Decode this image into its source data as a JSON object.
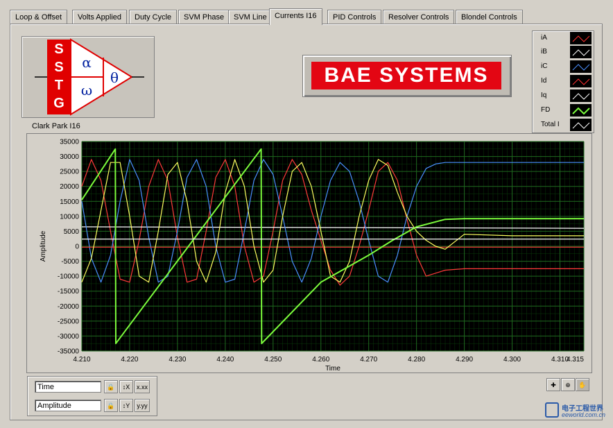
{
  "tabs": [
    {
      "label": "Loop & Offset",
      "active": false
    },
    {
      "label": "Volts Applied",
      "active": false
    },
    {
      "label": "Duty Cycle",
      "active": false
    },
    {
      "label": "SVM Phase",
      "active": false
    },
    {
      "label": "SVM Line",
      "active": false
    },
    {
      "label": "Currents I16",
      "active": true
    },
    {
      "label": "PID Controls",
      "active": false
    },
    {
      "label": "Resolver Controls",
      "active": false
    },
    {
      "label": "Blondel Controls",
      "active": false
    }
  ],
  "logo": {
    "letters": [
      "S",
      "S",
      "T",
      "G"
    ],
    "alpha": "α",
    "omega": "ω",
    "theta": "θ"
  },
  "bae": {
    "text": "BAE SYSTEMS"
  },
  "caption": "Clark Park  I16",
  "legend": [
    {
      "label": "iA",
      "color": "#ff3030"
    },
    {
      "label": "iB",
      "color": "#ffffff"
    },
    {
      "label": "iC",
      "color": "#4a90ff"
    },
    {
      "label": "Id",
      "color": "#ff3030"
    },
    {
      "label": "Iq",
      "color": "#ffffff"
    },
    {
      "label": "FD",
      "color": "#7cfc3c"
    },
    {
      "label": "Total I",
      "color": "#ffffff"
    }
  ],
  "controls": {
    "x_name": "Time",
    "y_name": "Amplitude",
    "x_fmt_label": "x.xx",
    "y_fmt_label": "y.yy"
  },
  "watermark": {
    "line1": "电子工程世界",
    "line2": "eeworld.com.cn"
  },
  "chart_data": {
    "type": "line",
    "xlabel": "Time",
    "ylabel": "Amplitude",
    "xlim": [
      4.21,
      4.315
    ],
    "ylim": [
      -35000,
      35000
    ],
    "xticks": [
      "4.210",
      "4.220",
      "4.230",
      "4.240",
      "4.250",
      "4.260",
      "4.270",
      "4.280",
      "4.290",
      "4.300",
      "4.310",
      "4.315"
    ],
    "xtick_values": [
      4.21,
      4.22,
      4.23,
      4.24,
      4.25,
      4.26,
      4.27,
      4.28,
      4.29,
      4.3,
      4.31,
      4.315
    ],
    "yticks": [
      "35000",
      "30000",
      "25000",
      "20000",
      "15000",
      "10000",
      "5000",
      "0",
      "-5000",
      "-10000",
      "-15000",
      "-20000",
      "-25000",
      "-30000",
      "-35000"
    ],
    "ytick_values": [
      35000,
      30000,
      25000,
      20000,
      15000,
      10000,
      5000,
      0,
      -5000,
      -10000,
      -15000,
      -20000,
      -25000,
      -30000,
      -35000
    ],
    "grid": true,
    "series": [
      {
        "name": "iA",
        "color": "#ff3a3a",
        "x": [
          4.21,
          4.212,
          4.214,
          4.216,
          4.218,
          4.22,
          4.222,
          4.224,
          4.226,
          4.228,
          4.23,
          4.232,
          4.234,
          4.236,
          4.238,
          4.24,
          4.242,
          4.244,
          4.246,
          4.248,
          4.25,
          4.252,
          4.254,
          4.256,
          4.258,
          4.26,
          4.262,
          4.264,
          4.266,
          4.268,
          4.27,
          4.272,
          4.274,
          4.276,
          4.278,
          4.28,
          4.282,
          4.284,
          4.286,
          4.29,
          4.3,
          4.31,
          4.315
        ],
        "y": [
          20000,
          29000,
          22000,
          5000,
          -11000,
          -12000,
          2000,
          20000,
          29000,
          22000,
          3000,
          -12000,
          -11000,
          5000,
          23000,
          29000,
          20000,
          0,
          -12000,
          -10000,
          5000,
          22000,
          29000,
          24000,
          12000,
          2000,
          -8000,
          -13000,
          -10000,
          0,
          12000,
          25000,
          28000,
          22000,
          9000,
          -3000,
          -10000,
          -9000,
          -8000,
          -7500,
          -7500,
          -7500,
          -7500
        ]
      },
      {
        "name": "iB",
        "color": "#ffffff",
        "x": [
          4.21,
          4.315
        ],
        "y": [
          6500,
          6000
        ]
      },
      {
        "name": "iC",
        "color": "#4a90ff",
        "x": [
          4.21,
          4.212,
          4.214,
          4.216,
          4.218,
          4.22,
          4.222,
          4.224,
          4.226,
          4.228,
          4.23,
          4.232,
          4.234,
          4.236,
          4.238,
          4.24,
          4.242,
          4.244,
          4.246,
          4.248,
          4.25,
          4.252,
          4.254,
          4.256,
          4.258,
          4.26,
          4.262,
          4.264,
          4.266,
          4.268,
          4.27,
          4.272,
          4.274,
          4.276,
          4.278,
          4.28,
          4.282,
          4.284,
          4.286,
          4.29,
          4.3,
          4.31,
          4.315
        ],
        "y": [
          15000,
          -4000,
          -12000,
          -3000,
          15000,
          29000,
          22000,
          3000,
          -12000,
          -10000,
          5000,
          23000,
          29000,
          20000,
          0,
          -12000,
          -11000,
          5000,
          22000,
          29000,
          24000,
          10000,
          -5000,
          -12000,
          -4000,
          10000,
          22000,
          28000,
          25000,
          15000,
          2000,
          -10000,
          -12000,
          -3000,
          10000,
          20000,
          26000,
          27500,
          28000,
          28000,
          28000,
          28000,
          28000
        ]
      },
      {
        "name": "Id",
        "color": "#ff3a3a",
        "x": [
          4.21,
          4.315
        ],
        "y": [
          -300,
          -300
        ]
      },
      {
        "name": "Iq",
        "color": "#ffff60",
        "x": [
          4.21,
          4.212,
          4.214,
          4.216,
          4.218,
          4.22,
          4.222,
          4.224,
          4.226,
          4.228,
          4.23,
          4.232,
          4.234,
          4.236,
          4.238,
          4.24,
          4.242,
          4.244,
          4.246,
          4.248,
          4.25,
          4.252,
          4.254,
          4.256,
          4.258,
          4.26,
          4.262,
          4.264,
          4.266,
          4.268,
          4.27,
          4.272,
          4.274,
          4.276,
          4.278,
          4.28,
          4.282,
          4.284,
          4.286,
          4.29,
          4.3,
          4.31,
          4.315
        ],
        "y": [
          -12000,
          -4000,
          12000,
          28000,
          28000,
          10000,
          -10000,
          -12000,
          5000,
          24000,
          28000,
          15000,
          -5000,
          -12000,
          -2000,
          18000,
          29000,
          20000,
          0,
          -12000,
          -8000,
          10000,
          25000,
          28000,
          20000,
          5000,
          -10000,
          -12000,
          -5000,
          10000,
          22000,
          29000,
          27000,
          18000,
          10000,
          5000,
          2000,
          0,
          -1000,
          4000,
          3500,
          3500,
          3500
        ]
      },
      {
        "name": "FD",
        "color": "#7cfc3c",
        "x": [
          4.21,
          4.217,
          4.2171,
          4.2475,
          4.2476,
          4.26,
          4.27,
          4.275,
          4.28,
          4.286,
          4.29,
          4.3,
          4.315
        ],
        "y": [
          15500,
          32500,
          -32500,
          32500,
          -32500,
          -12000,
          -3000,
          2000,
          6500,
          9000,
          9200,
          9200,
          9200
        ]
      },
      {
        "name": "Total I",
        "color": "#ffffff",
        "x": [
          4.21,
          4.315
        ],
        "y": [
          2400,
          2400
        ]
      }
    ]
  }
}
